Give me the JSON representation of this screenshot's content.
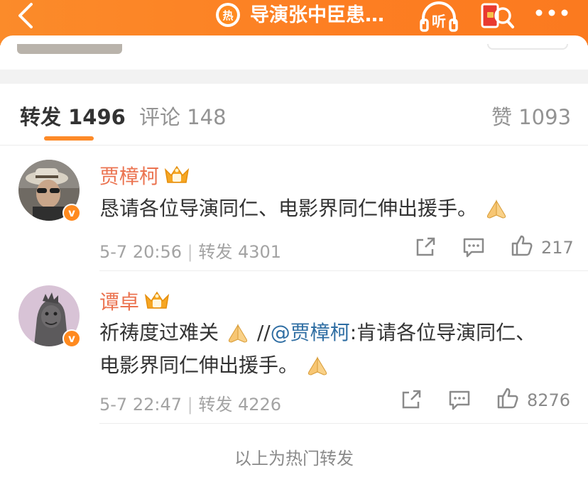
{
  "header": {
    "title": "导演张中臣患…",
    "hot_badge": "热",
    "listen_label": "听"
  },
  "tabs": [
    {
      "label": "转发 1496"
    },
    {
      "label": "评论 148"
    },
    {
      "label": "赞 1093"
    }
  ],
  "reposts": [
    {
      "username": "贾樟柯",
      "text": "恳请各位导演同仁、电影界同仁伸出援手。",
      "time": "5-7 20:56",
      "repost_label": "转发 4301",
      "likes": "217"
    },
    {
      "username": "谭卓",
      "text_prefix": "祈祷度过难关",
      "separator": " //",
      "mention": "@贾樟柯",
      "text_suffix": ":肯请各位导演同仁、",
      "text_line2": "电影界同仁伸出援手。",
      "time": "5-7 22:47",
      "repost_label": "转发 4226",
      "likes": "8276"
    }
  ],
  "verified_mark": "v",
  "footer": {
    "note": "以上为热门转发"
  },
  "colors": {
    "accent": "#fd8a28",
    "username": "#eb7350",
    "mention": "#2f6ea3"
  }
}
